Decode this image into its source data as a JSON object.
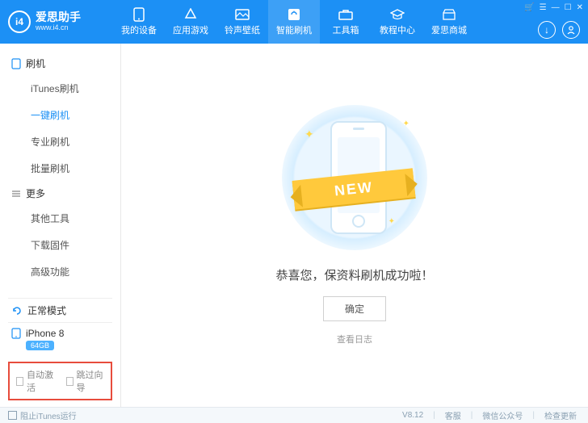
{
  "brand": {
    "logo": "i4",
    "title": "爱思助手",
    "subtitle": "www.i4.cn"
  },
  "nav": [
    {
      "label": "我的设备"
    },
    {
      "label": "应用游戏"
    },
    {
      "label": "铃声壁纸"
    },
    {
      "label": "智能刷机"
    },
    {
      "label": "工具箱"
    },
    {
      "label": "教程中心"
    },
    {
      "label": "爱思商城"
    }
  ],
  "nav_active_index": 3,
  "sidebar": {
    "group1_title": "刷机",
    "group1_items": [
      "iTunes刷机",
      "一键刷机",
      "专业刷机",
      "批量刷机"
    ],
    "group1_active_index": 1,
    "group2_title": "更多",
    "group2_items": [
      "其他工具",
      "下载固件",
      "高级功能"
    ],
    "mode_label": "正常模式",
    "device_name": "iPhone 8",
    "device_storage": "64GB",
    "auto_activate_label": "自动激活",
    "skip_guide_label": "跳过向导"
  },
  "main": {
    "ribbon_text": "NEW",
    "success_text": "恭喜您，保资料刷机成功啦！",
    "ok_button": "确定",
    "log_link": "查看日志"
  },
  "footer": {
    "block_itunes": "阻止iTunes运行",
    "version": "V8.12",
    "support": "客服",
    "wechat": "微信公众号",
    "check_update": "检查更新"
  }
}
